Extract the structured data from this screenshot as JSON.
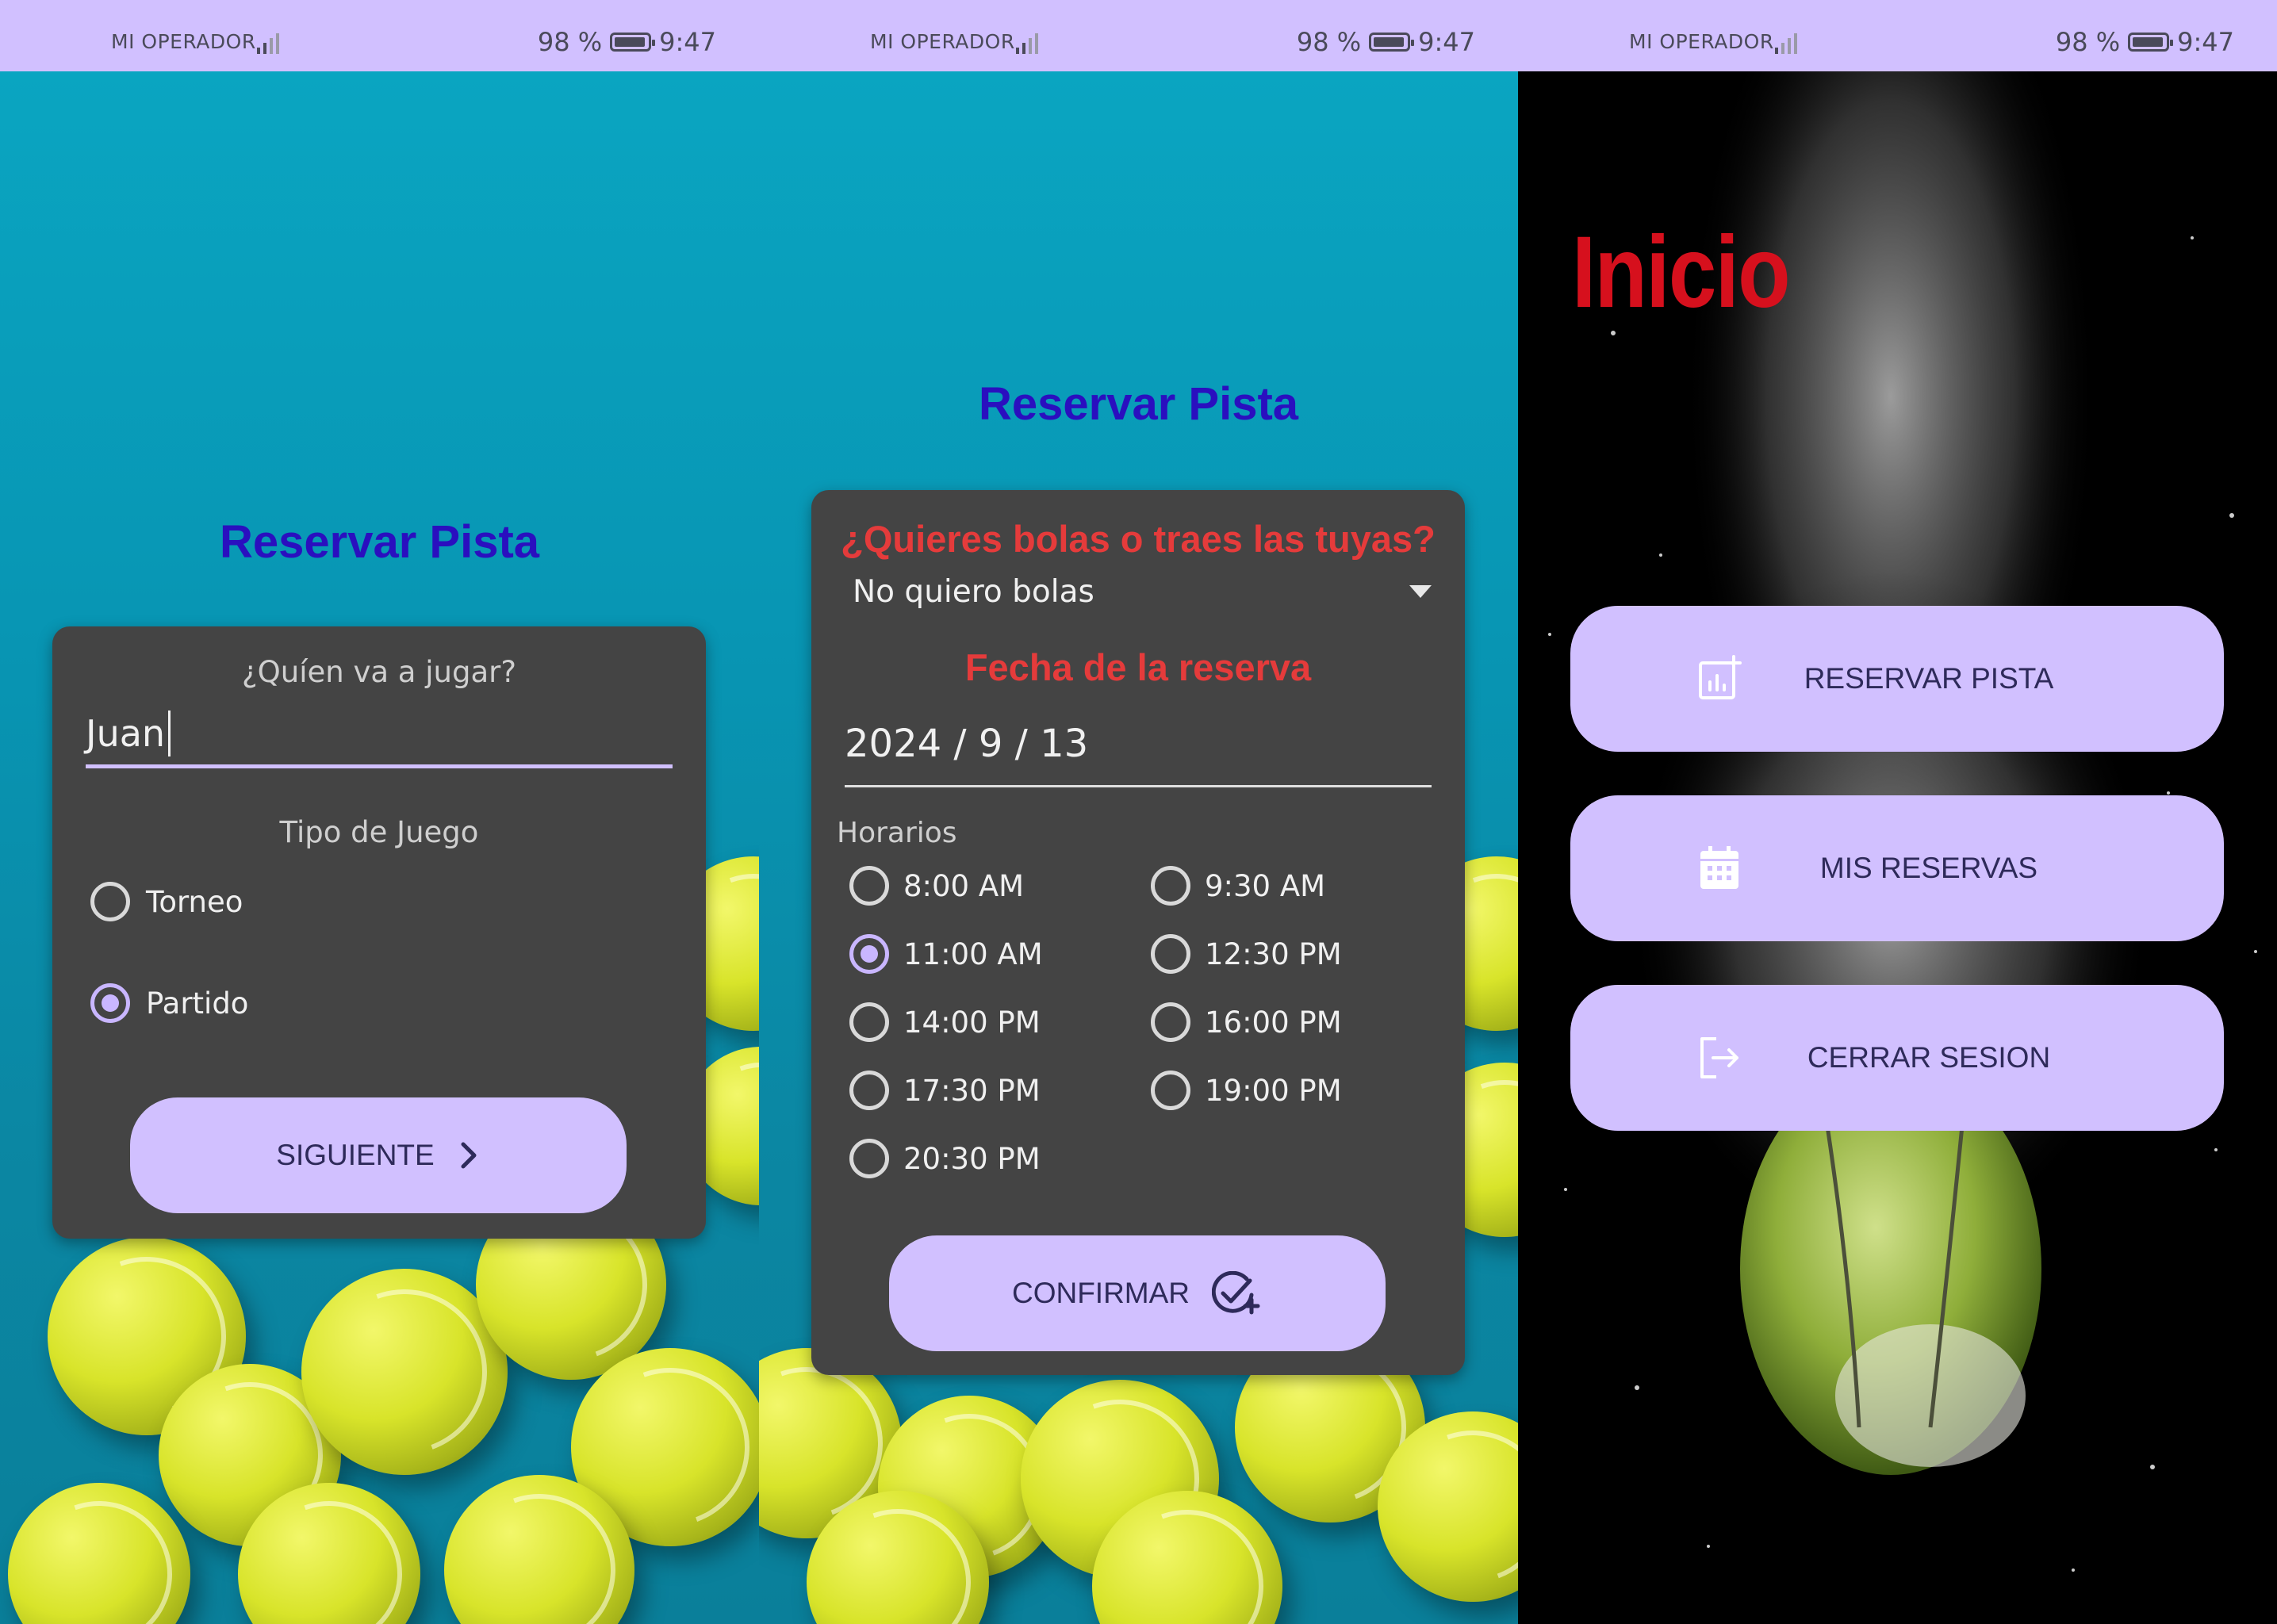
{
  "status_bar": {
    "operator": "MI OPERADOR",
    "battery": "98 %",
    "time": "9:47"
  },
  "screen1": {
    "title": "Reservar Pista",
    "who_label": "¿Quíen va a jugar?",
    "name_value": "Juan",
    "game_type_label": "Tipo de Juego",
    "options": [
      {
        "label": "Torneo",
        "selected": false
      },
      {
        "label": "Partido",
        "selected": true
      }
    ],
    "next_button": "SIGUIENTE"
  },
  "screen2": {
    "title": "Reservar Pista",
    "balls_question": "¿Quieres bolas o traes las tuyas?",
    "balls_selected": "No quiero bolas",
    "date_label": "Fecha de la reserva",
    "date_value": "2024 / 9 / 13",
    "times_label": "Horarios",
    "times": [
      {
        "label": "8:00 AM",
        "selected": false
      },
      {
        "label": "9:30 AM",
        "selected": false
      },
      {
        "label": "11:00 AM",
        "selected": true
      },
      {
        "label": "12:30 PM",
        "selected": false
      },
      {
        "label": "14:00 PM",
        "selected": false
      },
      {
        "label": "16:00 PM",
        "selected": false
      },
      {
        "label": "17:30 PM",
        "selected": false
      },
      {
        "label": "19:00 PM",
        "selected": false
      },
      {
        "label": "20:30 PM",
        "selected": false
      }
    ],
    "confirm_button": "CONFIRMAR"
  },
  "screen3": {
    "title": "Inicio",
    "buttons": [
      {
        "label": "RESERVAR PISTA",
        "icon": "add-chart-icon"
      },
      {
        "label": "MIS RESERVAS",
        "icon": "calendar-icon"
      },
      {
        "label": "CERRAR SESION",
        "icon": "logout-icon"
      }
    ]
  },
  "colors": {
    "accent": "#d1c0ff",
    "title_blue": "#2a0fbf",
    "question_red": "#e53b3b",
    "inicio_red": "#d6101d",
    "card": "#444444"
  }
}
